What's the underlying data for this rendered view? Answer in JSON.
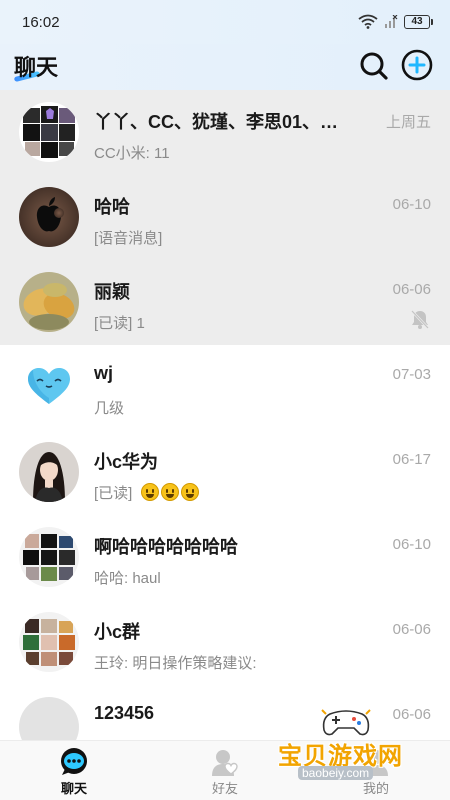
{
  "status_bar": {
    "time": "16:02",
    "battery": "43"
  },
  "header": {
    "title": "聊天"
  },
  "chats": [
    {
      "name": "丫丫、CC、犹瑾、李思01、…",
      "preview": "CC小米: 11",
      "time": "上周五",
      "pinned": true
    },
    {
      "name": "哈哈",
      "preview": "[语音消息]",
      "time": "06-10",
      "pinned": true
    },
    {
      "name": "丽颖",
      "preview": "[已读] 1",
      "time": "06-06",
      "pinned": true,
      "muted": true
    },
    {
      "name": "wj",
      "preview": "几级",
      "time": "07-03"
    },
    {
      "name": "小c华为",
      "preview": "[已读]",
      "time": "06-17",
      "emoji_count": 3
    },
    {
      "name": "啊哈哈哈哈哈哈哈",
      "preview": "哈哈: haul",
      "time": "06-10"
    },
    {
      "name": "小c群",
      "preview": "王玲: 明日操作策略建议:",
      "time": "06-06"
    },
    {
      "name": "123456",
      "preview": "",
      "time": "06-06"
    }
  ],
  "tabs": [
    {
      "label": "聊天",
      "icon": "chat-bubble-icon",
      "active": true
    },
    {
      "label": "好友",
      "icon": "friends-heart-icon",
      "active": false
    },
    {
      "label": "我的",
      "icon": "profile-icon",
      "active": false
    }
  ],
  "watermark": {
    "text": "宝贝游戏网",
    "url": "baobeiy.com"
  },
  "colors": {
    "accent": "#1fb7ff",
    "pinned_bg": "#ededed",
    "watermark": "#f2a400"
  }
}
